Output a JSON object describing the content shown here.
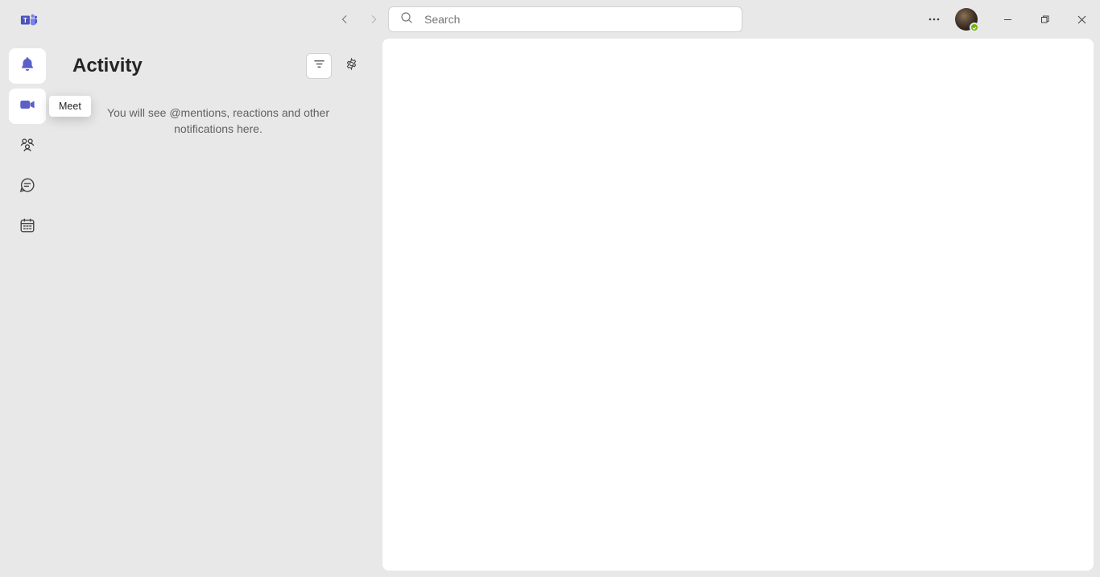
{
  "titlebar": {
    "search_placeholder": "Search"
  },
  "rail": {
    "items": [
      {
        "name": "activity",
        "active": true,
        "tooltip": ""
      },
      {
        "name": "meet",
        "active": false,
        "tooltip": "Meet"
      },
      {
        "name": "community",
        "active": false,
        "tooltip": ""
      },
      {
        "name": "chat",
        "active": false,
        "tooltip": ""
      },
      {
        "name": "calendar",
        "active": false,
        "tooltip": ""
      }
    ]
  },
  "activity": {
    "title": "Activity",
    "empty_message": "You will see @mentions, reactions and other notifications here."
  }
}
